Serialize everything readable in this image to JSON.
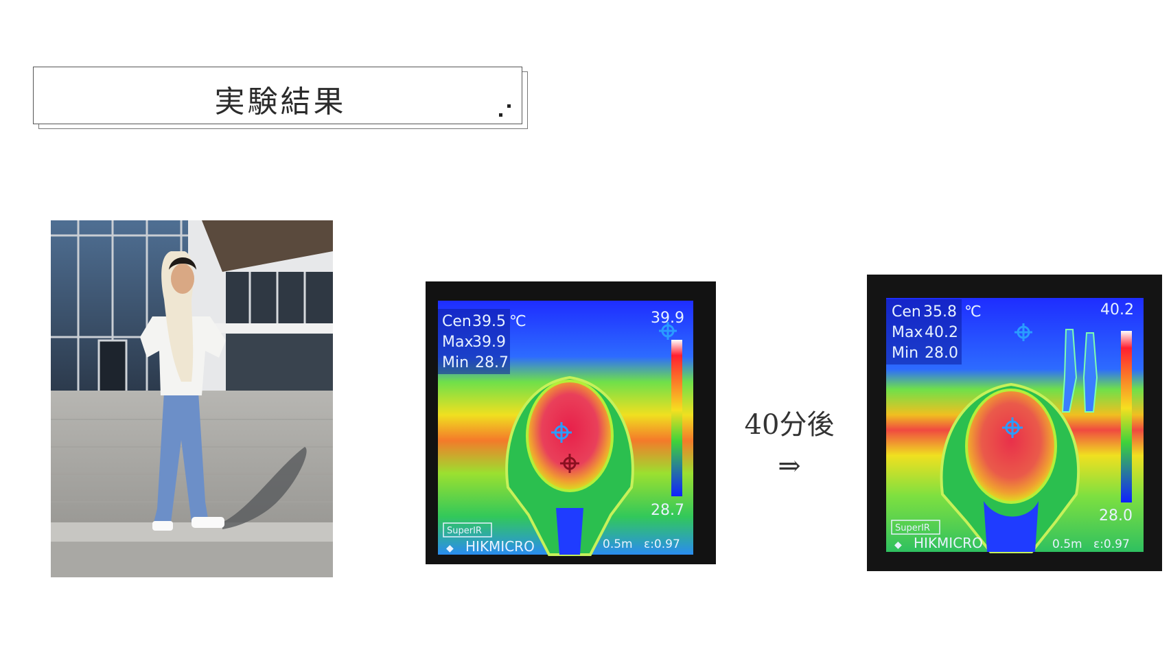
{
  "slide": {
    "title": "実験結果",
    "caption": "40分後",
    "arrow": "⇒"
  },
  "thermal_before": {
    "cen_label": "Cen",
    "cen_value": "39.5",
    "unit": "℃",
    "max_label": "Max",
    "max_value": "39.9",
    "min_label": "Min",
    "min_value": "28.7",
    "scale_top": "39.9",
    "scale_bottom": "28.7",
    "brand": "HIKMICRO",
    "badge": "SuperIR",
    "distance": "0.5m",
    "emissivity": "ε:0.97"
  },
  "thermal_after": {
    "cen_label": "Cen",
    "cen_value": "35.8",
    "unit": "℃",
    "max_label": "Max",
    "max_value": "40.2",
    "min_label": "Min",
    "min_value": "28.0",
    "scale_top": "40.2",
    "scale_bottom": "28.0",
    "brand": "HIKMICRO",
    "badge": "SuperIR",
    "distance": "0.5m",
    "emissivity": "ε:0.97"
  },
  "colors": {
    "thermal_blue": "#1f3cff",
    "thermal_green": "#3fd23a",
    "thermal_yellow": "#f2e51c",
    "thermal_red": "#e8403c",
    "overlay_text": "#e8f2ff"
  }
}
